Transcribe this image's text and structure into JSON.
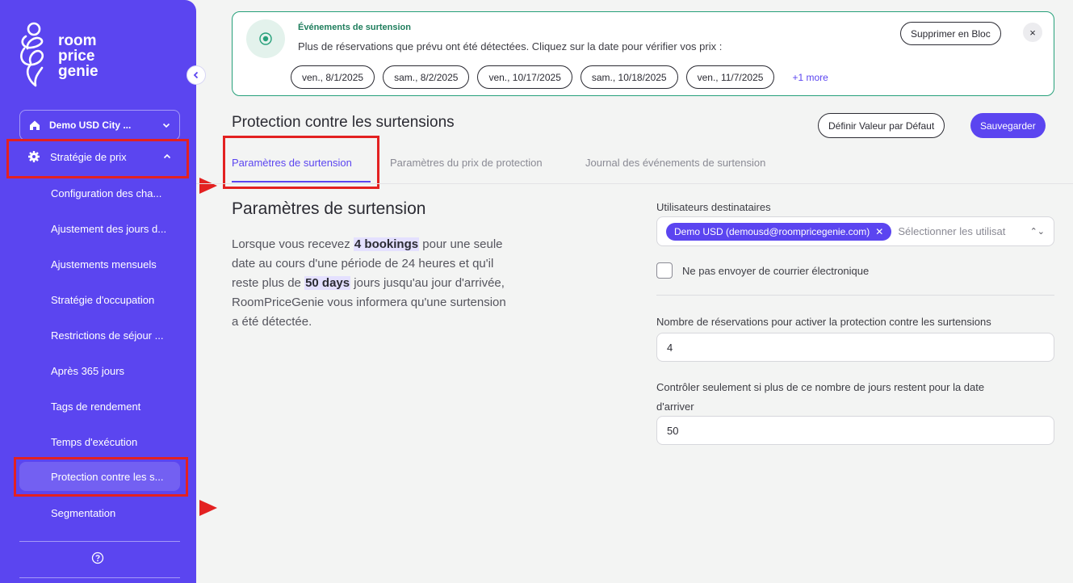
{
  "colors": {
    "brand": "#5b45f0",
    "success": "#1f7e5d",
    "highlight": "#e32121"
  },
  "sidebar": {
    "logo_lines": [
      "room",
      "price",
      "genie"
    ],
    "hotel": "Demo USD City ...",
    "section": "Stratégie de prix",
    "items": [
      {
        "label": "Configuration des cha..."
      },
      {
        "label": "Ajustement des jours d..."
      },
      {
        "label": "Ajustements mensuels"
      },
      {
        "label": "Stratégie d'occupation"
      },
      {
        "label": "Restrictions de séjour ..."
      },
      {
        "label": "Après 365 jours"
      },
      {
        "label": "Tags de rendement"
      },
      {
        "label": "Temps d'exécution"
      },
      {
        "label": "Protection contre les s..."
      },
      {
        "label": "Segmentation"
      }
    ],
    "active_item": "Protection contre les s..."
  },
  "banner": {
    "title": "Événements de surtension",
    "message": "Plus de réservations que prévu ont été détectées. Cliquez sur la date pour vérifier vos prix :",
    "dates": [
      "ven., 8/1/2025",
      "sam., 8/2/2025",
      "ven., 10/17/2025",
      "sam., 10/18/2025",
      "ven., 11/7/2025"
    ],
    "more": "+1 more",
    "delete_label": "Supprimer en Bloc",
    "close_label": "×"
  },
  "header": {
    "title": "Protection contre les surtensions",
    "default_label": "Définir Valeur par Défaut",
    "save_label": "Sauvegarder"
  },
  "tabs": [
    {
      "label": "Paramètres de surtension"
    },
    {
      "label": "Paramètres du prix de protection"
    },
    {
      "label": "Journal des événements de surtension"
    }
  ],
  "content": {
    "title": "Paramètres de surtension",
    "desc_1": "Lorsque vous recevez ",
    "desc_bookings": "4 bookings",
    "desc_2": " pour une seule date au cours d'une période de 24 heures et qu'il reste plus de ",
    "desc_days": "50 days",
    "desc_3": " jours jusqu'au jour d'arrivée, RoomPriceGenie vous informera qu'une surtension a été détectée."
  },
  "form": {
    "recipients_label": "Utilisateurs destinataires",
    "recipient_tag": "Demo USD (demousd@roompricegenie.com)",
    "recipient_placeholder": "Sélectionner les utilisat",
    "no_email_label": "Ne pas envoyer de courrier électronique",
    "bookings_label": "Nombre de réservations pour activer la protection contre les surtensions",
    "bookings_value": "4",
    "days_label_1": "Contrôler seulement si plus de ce nombre de jours restent pour la date",
    "days_label_2": "d'arriver",
    "days_value": "50"
  }
}
